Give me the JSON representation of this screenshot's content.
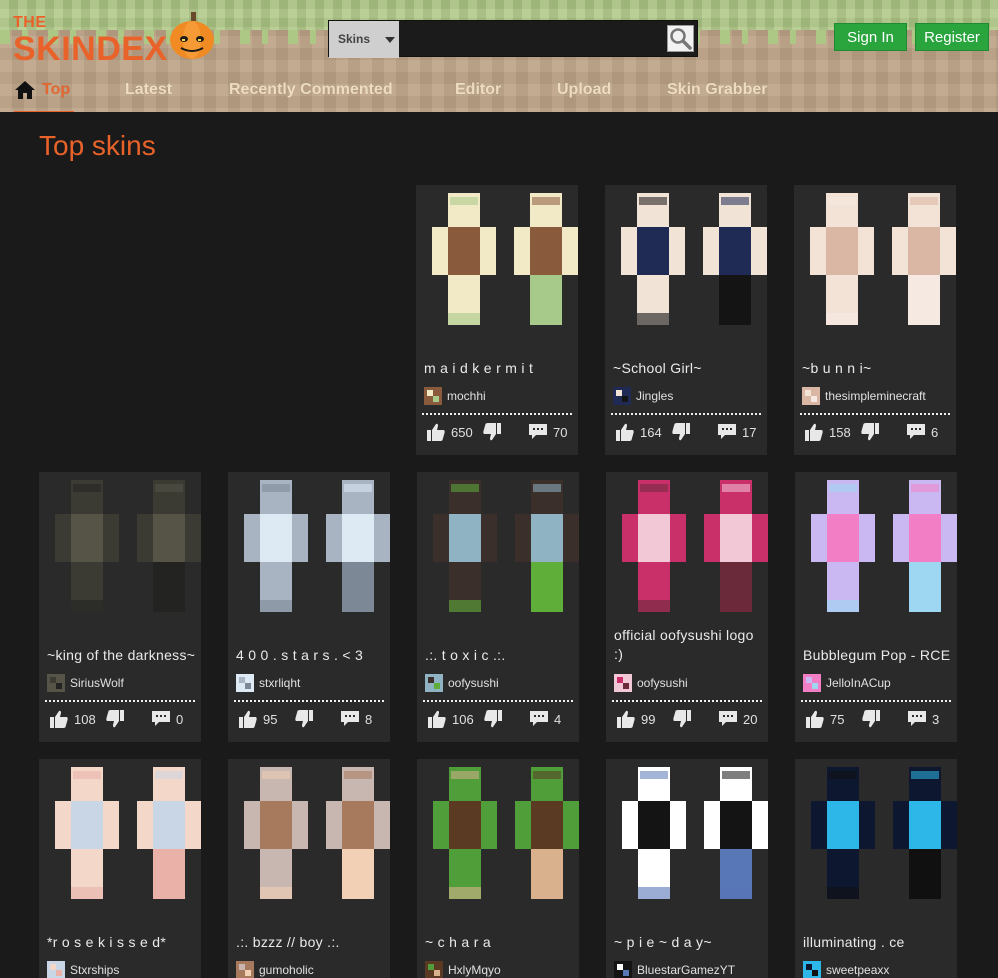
{
  "brand": {
    "the": "THE",
    "name": "SKINDEX",
    "accent": "#e8622a",
    "green": "#2aa43d"
  },
  "search": {
    "category": "Skins",
    "value": "",
    "placeholder": ""
  },
  "auth": {
    "sign_in": "Sign In",
    "register": "Register"
  },
  "nav": [
    {
      "label": "Top",
      "active": true
    },
    {
      "label": "Latest",
      "active": false
    },
    {
      "label": "Recently Commented",
      "active": false
    },
    {
      "label": "Editor",
      "active": false
    },
    {
      "label": "Upload",
      "active": false
    },
    {
      "label": "Skin Grabber",
      "active": false
    }
  ],
  "page_title": "Top skins",
  "skins": [
    {
      "title": "m a i d k e r m i t",
      "author": "mochhi",
      "likes": "650",
      "comments": "70",
      "palette": [
        "#f2e9c6",
        "#8a5a3c",
        "#a7c98a"
      ]
    },
    {
      "title": "~School Girl~",
      "author": "Jingles",
      "likes": "164",
      "comments": "17",
      "palette": [
        "#f1e3d6",
        "#1f2a55",
        "#141414"
      ]
    },
    {
      "title": "~b u n n i~",
      "author": "thesimpleminecraft",
      "likes": "158",
      "comments": "6",
      "palette": [
        "#f3e3d6",
        "#d9b7a4",
        "#f6e9e2"
      ]
    },
    {
      "title": "~king of the darkness~",
      "author": "SiriusWolf",
      "likes": "108",
      "comments": "0",
      "palette": [
        "#3b3a33",
        "#565447",
        "#232421"
      ]
    },
    {
      "title": "4 0 0 . s t a r s . < 3",
      "author": "stxrliqht",
      "likes": "95",
      "comments": "8",
      "palette": [
        "#a9b4c3",
        "#dde9f3",
        "#7d8896"
      ]
    },
    {
      "title": ".:. t o x i c .:.",
      "author": "oofysushi",
      "likes": "106",
      "comments": "4",
      "palette": [
        "#3a2f2a",
        "#8fb3c2",
        "#5fae3a"
      ]
    },
    {
      "title": "official oofysushi logo :)",
      "author": "oofysushi",
      "likes": "99",
      "comments": "20",
      "palette": [
        "#c9306a",
        "#f2c7d6",
        "#6b2a3a"
      ]
    },
    {
      "title": "Bubblegum Pop - RCE",
      "author": "JelloInACup",
      "likes": "75",
      "comments": "3",
      "palette": [
        "#c9b8f2",
        "#f27fc5",
        "#9ed7f2"
      ]
    },
    {
      "title": "*r o s e k i s s e d*",
      "author": "Stxrships",
      "likes": "",
      "comments": "",
      "palette": [
        "#f3d7c9",
        "#c9d6e6",
        "#eab1a8"
      ]
    },
    {
      "title": ".:. bzzz // boy .:.",
      "author": "gumoholic",
      "likes": "",
      "comments": "",
      "palette": [
        "#c7b7b0",
        "#a77a5e",
        "#f1d0b6"
      ]
    },
    {
      "title": "~ c h a r a",
      "author": "HxlyMqyo",
      "likes": "",
      "comments": "",
      "palette": [
        "#4f9e3a",
        "#5a3a22",
        "#d9b18c"
      ]
    },
    {
      "title": "~ p i e ~ d a y~",
      "author": "BluestarGamezYT",
      "likes": "",
      "comments": "",
      "palette": [
        "#ffffff",
        "#141414",
        "#5877b7"
      ]
    },
    {
      "title": "illuminating . ce",
      "author": "sweetpeaxx",
      "likes": "",
      "comments": "",
      "palette": [
        "#0e1730",
        "#2db7e8",
        "#101010"
      ]
    }
  ]
}
